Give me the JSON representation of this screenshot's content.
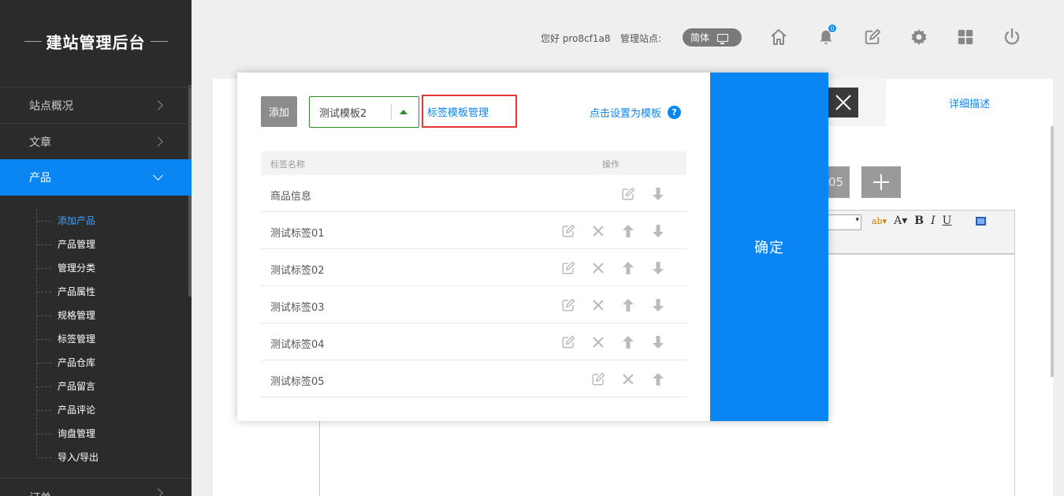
{
  "sidebar": {
    "title": "建站管理后台",
    "nav": [
      {
        "label": "站点概况"
      },
      {
        "label": "文章"
      },
      {
        "label": "产品"
      }
    ],
    "sub": [
      "添加产品",
      "产品管理",
      "管理分类",
      "产品属性",
      "规格管理",
      "标签管理",
      "产品仓库",
      "产品留言",
      "产品评论",
      "询盘管理",
      "导入/导出"
    ],
    "bottom_label": "订单"
  },
  "topbar": {
    "greeting": "您好 pro8cf1a8",
    "site_label": "管理站点:",
    "lang": "简体",
    "notification_count": "0"
  },
  "page": {
    "tab_detail": "详细描述",
    "pager_partial": "05"
  },
  "modal": {
    "add_label": "添加",
    "template_value": "测试模板2",
    "template_manage": "标签模板管理",
    "set_template": "点击设置为模板",
    "help": "?",
    "confirm": "确定",
    "col_name": "标签名称",
    "col_op": "操作",
    "rows": [
      {
        "name": "商品信息"
      },
      {
        "name": "测试标签01"
      },
      {
        "name": "测试标签02"
      },
      {
        "name": "测试标签03"
      },
      {
        "name": "测试标签04"
      },
      {
        "name": "测试标签05"
      }
    ]
  }
}
